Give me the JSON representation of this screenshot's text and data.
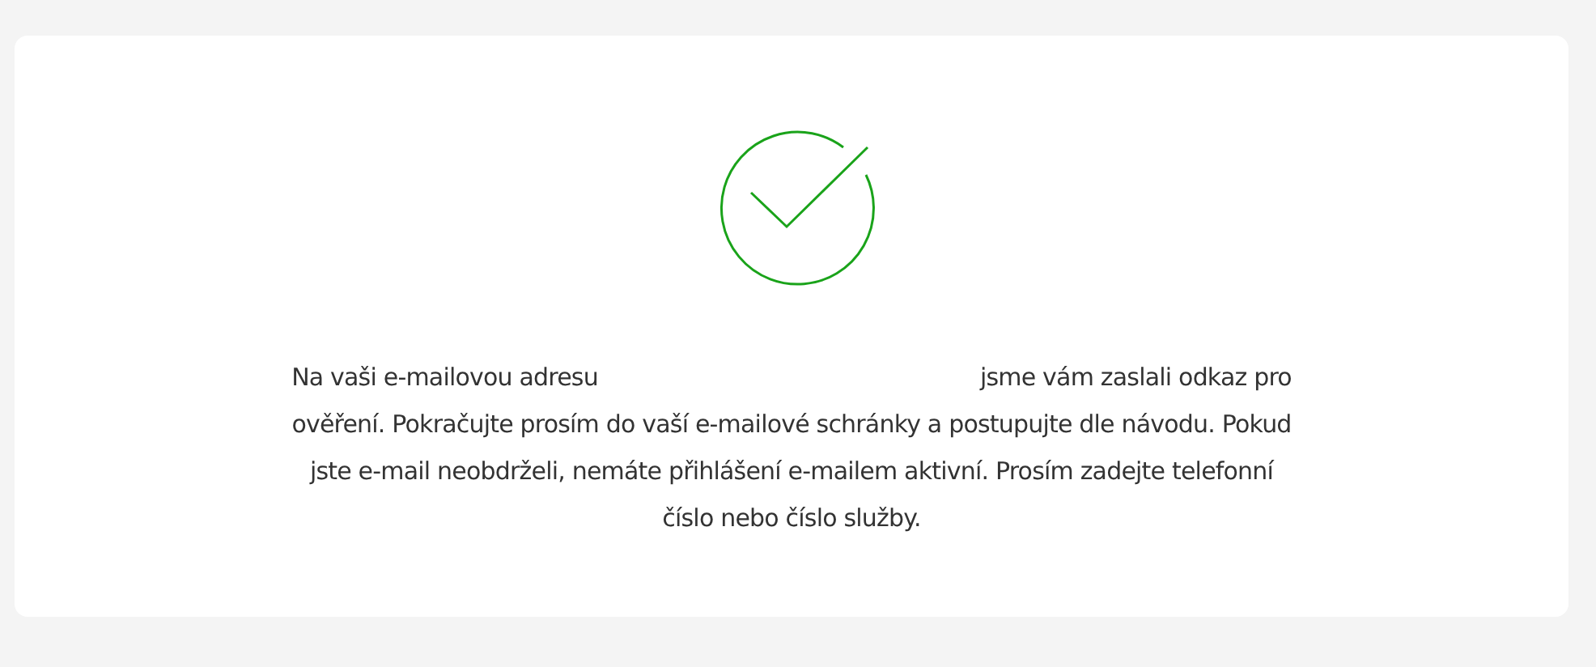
{
  "message": {
    "before_email": "Na vaši e-mailovou adresu",
    "after_email": "jsme vám zaslali odkaz pro ověření. Pokračujte prosím do vaší e-mailové schránky a postupujte dle návodu. Pokud jste e-mail neobdrželi, nemáte přihlášení e-mailem aktivní. Prosím zadejte telefonní číslo nebo číslo služby."
  }
}
